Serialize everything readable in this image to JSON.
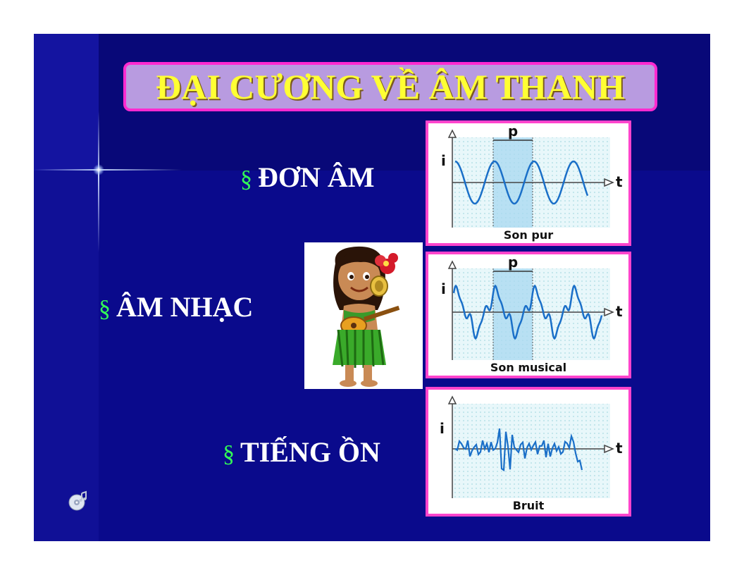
{
  "slide": {
    "title": "ĐẠI CƯƠNG VỀ ÂM THANH",
    "bullet_symbol": "§",
    "bullets": [
      {
        "label": "ĐƠN ÂM"
      },
      {
        "label": "ÂM NHẠC"
      },
      {
        "label": "TIẾNG ỒN"
      }
    ]
  },
  "panels": [
    {
      "caption": "Son pur",
      "y_axis": "i",
      "x_axis": "t",
      "period_label": "p"
    },
    {
      "caption": "Son musical",
      "y_axis": "i",
      "x_axis": "t",
      "period_label": "p"
    },
    {
      "caption": "Bruit",
      "y_axis": "i",
      "x_axis": "t"
    }
  ],
  "icons": {
    "flare": "lens-flare-icon",
    "girl": "hula-girl-ukulele-icon",
    "sound": "sound-cd-icon"
  },
  "colors": {
    "background": "#0a0a8c",
    "title_box": "#b89be0",
    "title_border": "#ff2ad0",
    "title_text": "#ffff33",
    "bullet_mark": "#33ff55",
    "bullet_text": "#ffffff",
    "panel_border": "#ff44cc",
    "wave": "#1a6fc8"
  }
}
